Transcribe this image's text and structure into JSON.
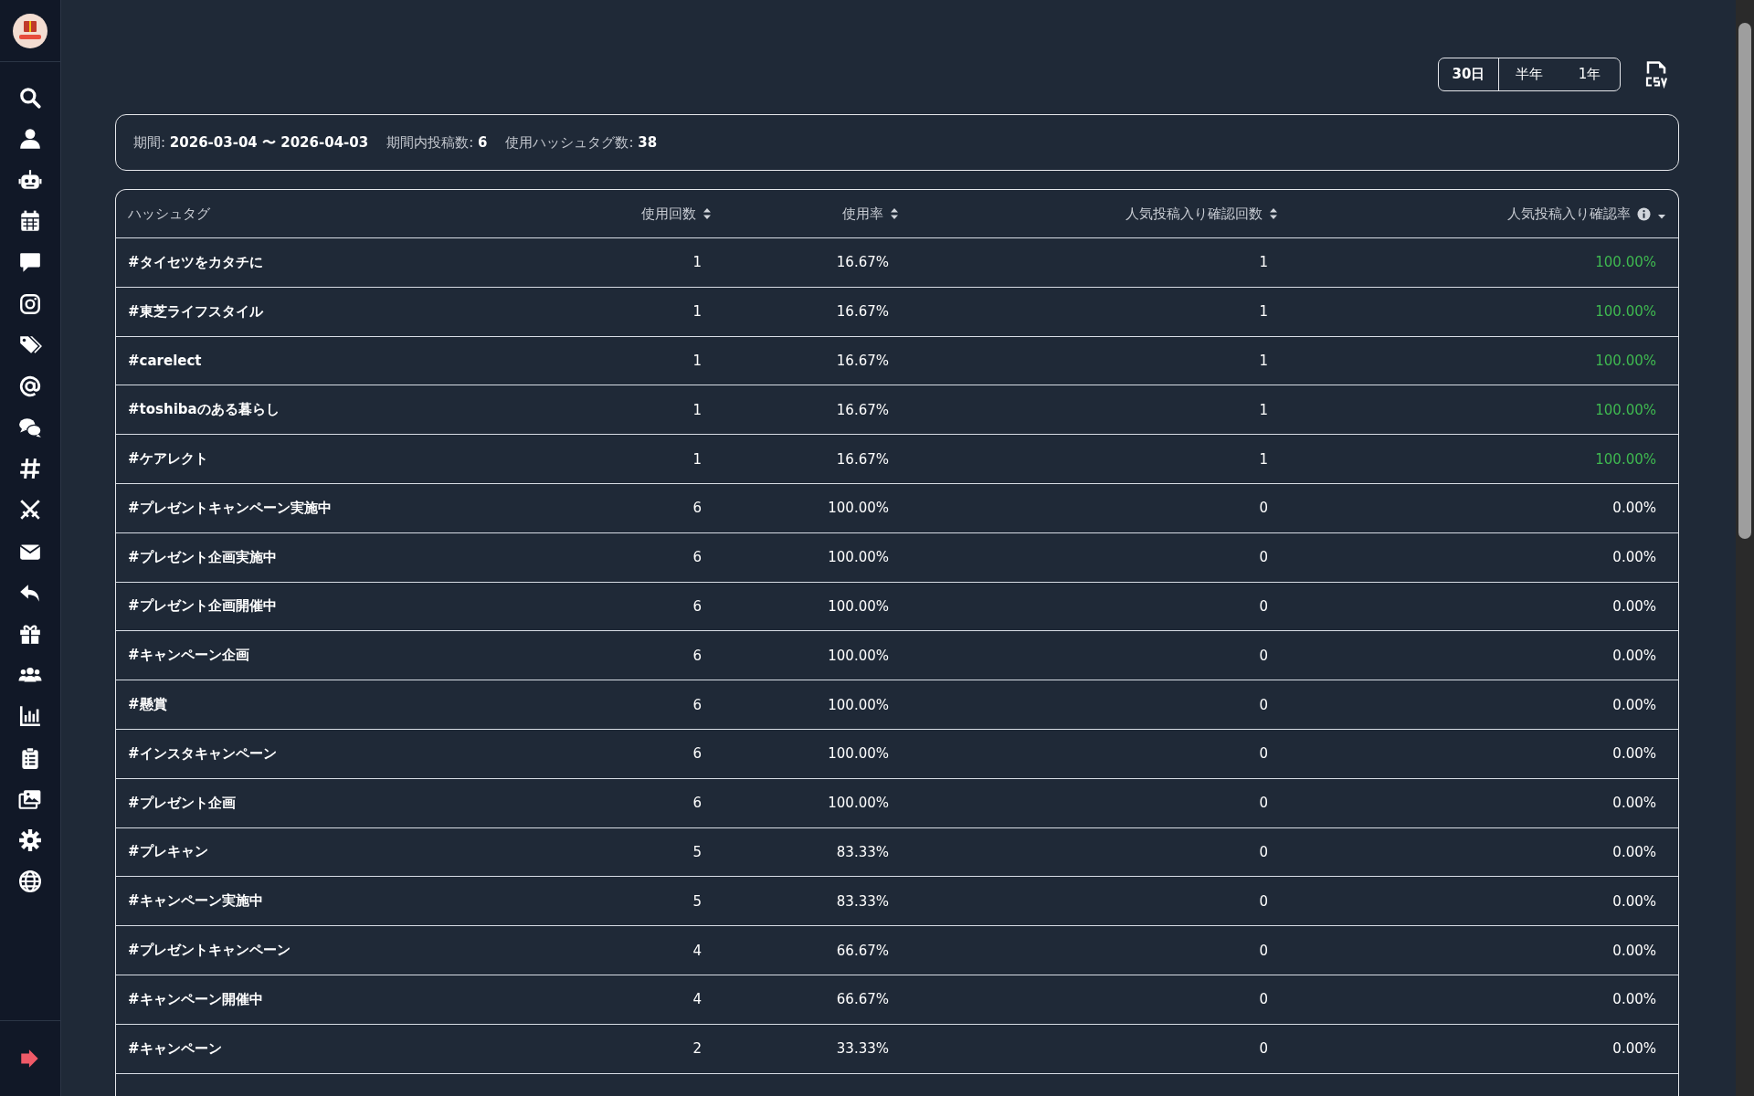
{
  "period_tabs": [
    {
      "label": "30日",
      "selected": true
    },
    {
      "label": "半年",
      "selected": false
    },
    {
      "label": "1年",
      "selected": false
    }
  ],
  "summary": [
    {
      "label": "期間:",
      "value": "2026-03-04 〜 2026-04-03"
    },
    {
      "label": "期間内投稿数:",
      "value": "6"
    },
    {
      "label": "使用ハッシュタグ数:",
      "value": "38"
    }
  ],
  "table": {
    "columns": [
      {
        "label": "ハッシュタグ",
        "sortable": false,
        "info": false
      },
      {
        "label": "使用回数",
        "sortable": true,
        "sorted": false,
        "info": false
      },
      {
        "label": "使用率",
        "sortable": true,
        "sorted": false,
        "info": false
      },
      {
        "label": "人気投稿入り確認回数",
        "sortable": true,
        "sorted": false,
        "info": false
      },
      {
        "label": "人気投稿入り確認率",
        "sortable": true,
        "sorted": true,
        "info": true
      }
    ],
    "rows": [
      {
        "hashtag": "#タイセツをカタチに",
        "count": "1",
        "usage_rate": "16.67%",
        "popular_count": "1",
        "popular_rate": "100.00%",
        "highlighted": true
      },
      {
        "hashtag": "#東芝ライフスタイル",
        "count": "1",
        "usage_rate": "16.67%",
        "popular_count": "1",
        "popular_rate": "100.00%",
        "highlighted": true
      },
      {
        "hashtag": "#carelect",
        "count": "1",
        "usage_rate": "16.67%",
        "popular_count": "1",
        "popular_rate": "100.00%",
        "highlighted": true
      },
      {
        "hashtag": "#toshibaのある暮らし",
        "count": "1",
        "usage_rate": "16.67%",
        "popular_count": "1",
        "popular_rate": "100.00%",
        "highlighted": true
      },
      {
        "hashtag": "#ケアレクト",
        "count": "1",
        "usage_rate": "16.67%",
        "popular_count": "1",
        "popular_rate": "100.00%",
        "highlighted": true
      },
      {
        "hashtag": "#プレゼントキャンペーン実施中",
        "count": "6",
        "usage_rate": "100.00%",
        "popular_count": "0",
        "popular_rate": "0.00%",
        "highlighted": false
      },
      {
        "hashtag": "#プレゼント企画実施中",
        "count": "6",
        "usage_rate": "100.00%",
        "popular_count": "0",
        "popular_rate": "0.00%",
        "highlighted": false
      },
      {
        "hashtag": "#プレゼント企画開催中",
        "count": "6",
        "usage_rate": "100.00%",
        "popular_count": "0",
        "popular_rate": "0.00%",
        "highlighted": false
      },
      {
        "hashtag": "#キャンペーン企画",
        "count": "6",
        "usage_rate": "100.00%",
        "popular_count": "0",
        "popular_rate": "0.00%",
        "highlighted": false
      },
      {
        "hashtag": "#懸賞",
        "count": "6",
        "usage_rate": "100.00%",
        "popular_count": "0",
        "popular_rate": "0.00%",
        "highlighted": false
      },
      {
        "hashtag": "#インスタキャンペーン",
        "count": "6",
        "usage_rate": "100.00%",
        "popular_count": "0",
        "popular_rate": "0.00%",
        "highlighted": false
      },
      {
        "hashtag": "#プレゼント企画",
        "count": "6",
        "usage_rate": "100.00%",
        "popular_count": "0",
        "popular_rate": "0.00%",
        "highlighted": false
      },
      {
        "hashtag": "#プレキャン",
        "count": "5",
        "usage_rate": "83.33%",
        "popular_count": "0",
        "popular_rate": "0.00%",
        "highlighted": false
      },
      {
        "hashtag": "#キャンペーン実施中",
        "count": "5",
        "usage_rate": "83.33%",
        "popular_count": "0",
        "popular_rate": "0.00%",
        "highlighted": false
      },
      {
        "hashtag": "#プレゼントキャンペーン",
        "count": "4",
        "usage_rate": "66.67%",
        "popular_count": "0",
        "popular_rate": "0.00%",
        "highlighted": false
      },
      {
        "hashtag": "#キャンペーン開催中",
        "count": "4",
        "usage_rate": "66.67%",
        "popular_count": "0",
        "popular_rate": "0.00%",
        "highlighted": false
      },
      {
        "hashtag": "#キャンペーン",
        "count": "2",
        "usage_rate": "33.33%",
        "popular_count": "0",
        "popular_rate": "0.00%",
        "highlighted": false
      }
    ]
  }
}
